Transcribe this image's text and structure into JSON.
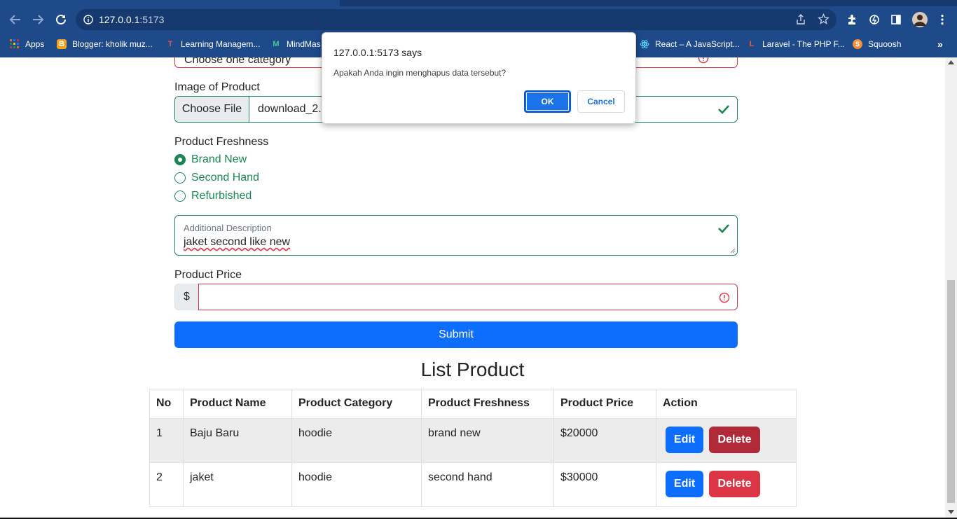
{
  "browser": {
    "url_host": "127.0.0.1",
    "url_port": ":5173",
    "bookmarks": [
      {
        "label": "Apps",
        "icon": "apps-grid-icon"
      },
      {
        "label": "Blogger: kholik muz...",
        "icon": "blogger-icon"
      },
      {
        "label": "Learning Managem...",
        "icon": "lms-icon"
      },
      {
        "label": "MindMas",
        "icon": "mindmaster-icon"
      },
      {
        "label": "React – A JavaScript...",
        "icon": "react-icon"
      },
      {
        "label": "Laravel - The PHP F...",
        "icon": "laravel-icon"
      },
      {
        "label": "Squoosh",
        "icon": "squoosh-icon"
      }
    ]
  },
  "form": {
    "category_partial": "Choose one category",
    "image_label": "Image of Product",
    "file_button": "Choose File",
    "file_name": "download_2.",
    "freshness_label": "Product Freshness",
    "freshness_options": [
      "Brand New",
      "Second Hand",
      "Refurbished"
    ],
    "freshness_selected": "Brand New",
    "description_label": "Additional Description",
    "description_value": "jaket second like new",
    "price_label": "Product Price",
    "price_prefix": "$",
    "price_value": "",
    "submit_label": "Submit"
  },
  "list": {
    "title": "List Product",
    "headers": [
      "No",
      "Product Name",
      "Product Category",
      "Product Freshness",
      "Product Price",
      "Action"
    ],
    "rows": [
      {
        "no": "1",
        "name": "Baju Baru",
        "category": "hoodie",
        "freshness": "brand new",
        "price": "$20000"
      },
      {
        "no": "2",
        "name": "jaket",
        "category": "hoodie",
        "freshness": "second hand",
        "price": "$30000"
      }
    ],
    "edit_label": "Edit",
    "delete_label": "Delete"
  },
  "dialog": {
    "title": "127.0.0.1:5173 says",
    "message": "Apakah Anda ingin menghapus data tersebut?",
    "ok_label": "OK",
    "cancel_label": "Cancel"
  },
  "colors": {
    "primary": "#0d6efd",
    "danger": "#dc3545",
    "success": "#198754",
    "browser_frame": "#1e4a8a"
  }
}
